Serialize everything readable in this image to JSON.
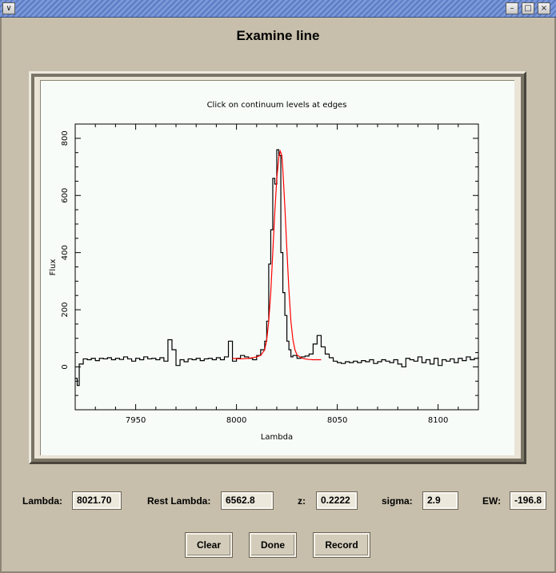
{
  "window": {
    "menu_icon": "chevron-down-icon",
    "controls": [
      "minimize-icon",
      "maximize-icon",
      "close-icon"
    ]
  },
  "dialog_title": "Examine line",
  "chart_data": {
    "type": "line",
    "title": "Click on continuum levels at edges",
    "xlabel": "Lambda",
    "ylabel": "Flux",
    "xlim": [
      7920,
      8120
    ],
    "ylim": [
      -150,
      850
    ],
    "xticks": [
      7950,
      8000,
      8050,
      8100
    ],
    "yticks": [
      0,
      200,
      400,
      600,
      800
    ],
    "grid": false,
    "series": [
      {
        "style": "step",
        "color": "#000000",
        "x": [
          7920,
          7921,
          7922,
          7924,
          7926,
          7928,
          7930,
          7932,
          7934,
          7936,
          7938,
          7940,
          7942,
          7944,
          7946,
          7948,
          7950,
          7952,
          7954,
          7956,
          7958,
          7960,
          7962,
          7964,
          7966,
          7968,
          7970,
          7972,
          7974,
          7976,
          7978,
          7980,
          7982,
          7984,
          7986,
          7988,
          7990,
          7992,
          7994,
          7996,
          7998,
          8000,
          8002,
          8004,
          8006,
          8008,
          8010,
          8012,
          8014,
          8015,
          8016,
          8017,
          8018,
          8019,
          8020,
          8021,
          8022,
          8023,
          8024,
          8025,
          8026,
          8027,
          8028,
          8030,
          8032,
          8034,
          8036,
          8038,
          8040,
          8042,
          8044,
          8046,
          8048,
          8050,
          8052,
          8054,
          8056,
          8058,
          8060,
          8062,
          8064,
          8066,
          8068,
          8070,
          8072,
          8074,
          8076,
          8078,
          8080,
          8082,
          8084,
          8086,
          8088,
          8090,
          8092,
          8094,
          8096,
          8098,
          8100,
          8102,
          8104,
          8106,
          8108,
          8110,
          8112,
          8114,
          8116,
          8118,
          8120
        ],
        "y": [
          -40,
          -65,
          10,
          28,
          25,
          30,
          22,
          30,
          28,
          32,
          25,
          30,
          26,
          35,
          28,
          20,
          30,
          25,
          35,
          28,
          30,
          25,
          32,
          20,
          95,
          60,
          5,
          25,
          18,
          28,
          25,
          30,
          22,
          28,
          30,
          25,
          32,
          25,
          35,
          90,
          20,
          30,
          40,
          35,
          30,
          25,
          40,
          60,
          90,
          160,
          360,
          480,
          660,
          640,
          760,
          740,
          400,
          260,
          180,
          90,
          60,
          35,
          40,
          30,
          35,
          38,
          45,
          80,
          110,
          70,
          45,
          32,
          20,
          15,
          12,
          18,
          15,
          20,
          15,
          22,
          18,
          25,
          12,
          18,
          25,
          20,
          15,
          25,
          10,
          0,
          30,
          25,
          20,
          35,
          15,
          25,
          10,
          30,
          5,
          25,
          20,
          28,
          15,
          30,
          22,
          35,
          25,
          30,
          35
        ]
      },
      {
        "style": "line",
        "color": "#ff0000",
        "x": [
          7998,
          8002,
          8006,
          8008,
          8010,
          8012,
          8014,
          8015,
          8016,
          8017,
          8018,
          8019,
          8020,
          8021,
          8021.7,
          8022.5,
          8023,
          8024,
          8025,
          8026,
          8027,
          8028,
          8029,
          8030,
          8032,
          8034,
          8036,
          8038,
          8040,
          8042
        ],
        "y": [
          30,
          28,
          30,
          32,
          35,
          40,
          60,
          95,
          160,
          260,
          400,
          540,
          660,
          735,
          755,
          740,
          690,
          560,
          410,
          270,
          160,
          95,
          60,
          42,
          32,
          28,
          26,
          25,
          25,
          25
        ]
      }
    ]
  },
  "fields": {
    "lambda": {
      "label": "Lambda:",
      "value": "8021.70"
    },
    "rest_lambda": {
      "label": "Rest Lambda:",
      "value": "6562.8"
    },
    "z": {
      "label": "z:",
      "value": "0.2222"
    },
    "sigma": {
      "label": "sigma:",
      "value": "2.9"
    },
    "ew": {
      "label": "EW:",
      "value": "-196.8"
    }
  },
  "buttons": {
    "clear": "Clear",
    "done": "Done",
    "record": "Record"
  }
}
